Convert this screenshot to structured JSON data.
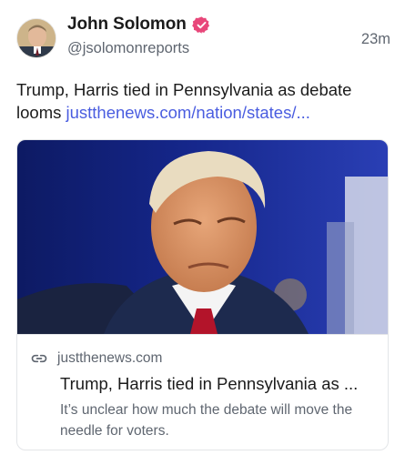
{
  "author": {
    "name": "John Solomon",
    "handle": "@jsolomonreports",
    "time": "23m",
    "verified_color": "#e8477a"
  },
  "post": {
    "text": "Trump, Harris tied in Pennsylvania as debate looms ",
    "link": "justthenews.com/nation/states/..."
  },
  "card": {
    "domain": "justthenews.com",
    "title": "Trump, Harris tied in Pennsylvania as ...",
    "description": "It’s unclear how much the debate will move the needle for voters."
  },
  "colors": {
    "link": "#4a5de0",
    "secondary_text": "#5f6670",
    "border": "#e3e5e8"
  },
  "icons": {
    "verified": "verified-badge-icon",
    "link": "link-chain-icon"
  }
}
